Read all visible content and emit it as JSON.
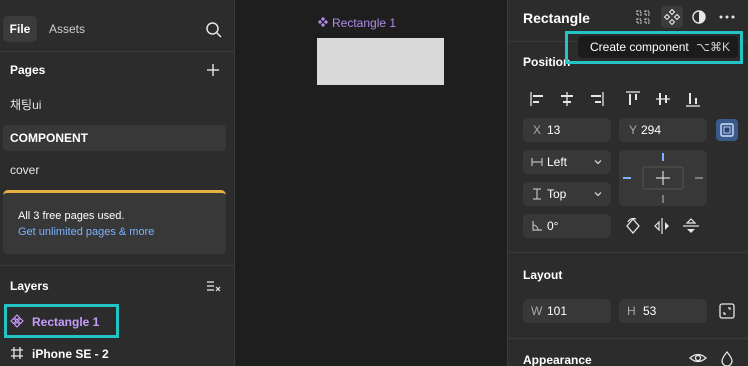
{
  "left_panel": {
    "tabs": {
      "file": "File",
      "assets": "Assets"
    },
    "pages": {
      "title": "Pages",
      "items": [
        {
          "label": "채팅ui"
        },
        {
          "label": "COMPONENT"
        },
        {
          "label": "cover"
        }
      ]
    },
    "limit": {
      "message": "All 3 free pages used.",
      "link": "Get unlimited pages & more"
    },
    "layers": {
      "title": "Layers",
      "items": [
        {
          "label": "Rectangle 1",
          "icon": "component-icon"
        },
        {
          "label": "iPhone SE - 2",
          "icon": "frame-icon"
        }
      ]
    }
  },
  "canvas": {
    "frame_label": "Rectangle 1"
  },
  "right_panel": {
    "title": "Rectangle",
    "tooltip": {
      "label": "Create component",
      "shortcut": "⌥⌘K"
    },
    "position": {
      "title": "Position",
      "x_label": "X",
      "x_value": "13",
      "y_label": "Y",
      "y_value": "294",
      "h_constraint": "Left",
      "v_constraint": "Top",
      "rotation": "0°"
    },
    "layout": {
      "title": "Layout",
      "w_label": "W",
      "w_value": "101",
      "h_label": "H",
      "h_value": "53"
    },
    "appearance": {
      "title": "Appearance"
    }
  },
  "colors": {
    "highlight": "#22c4c4",
    "component": "#c79cff",
    "link": "#7cb2ff",
    "warning": "#e3b341"
  }
}
